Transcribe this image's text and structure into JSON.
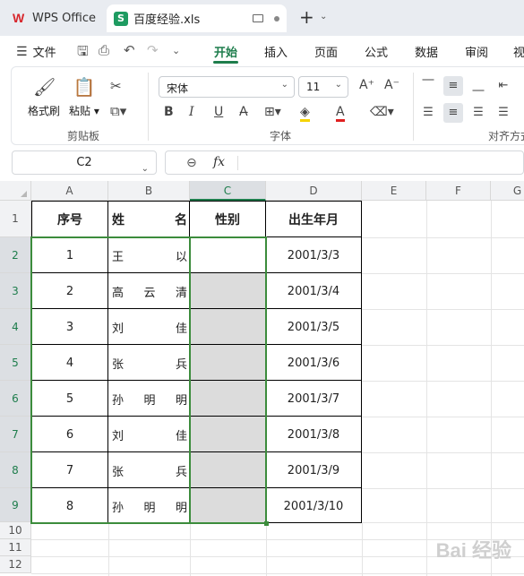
{
  "tabs": {
    "app_label": "WPS Office",
    "file_label": "百度经验.xls",
    "file_icon_letter": "S"
  },
  "menu": {
    "file": "文件",
    "tabs": [
      "开始",
      "插入",
      "页面",
      "公式",
      "数据",
      "审阅",
      "视"
    ],
    "active": "开始"
  },
  "ribbon": {
    "format_painter": "格式刷",
    "paste": "粘贴",
    "clipboard_group": "剪贴板",
    "font_group": "字体",
    "align_group": "对齐方式",
    "font_name": "宋体",
    "font_size": "11"
  },
  "formula": {
    "cell_ref": "C2",
    "fx": "fx",
    "content": ""
  },
  "sheet": {
    "columns": [
      "A",
      "B",
      "C",
      "D",
      "E",
      "F",
      "G"
    ],
    "rows": [
      "1",
      "2",
      "3",
      "4",
      "5",
      "6",
      "7",
      "8",
      "9",
      "10",
      "11",
      "12"
    ],
    "headers": {
      "a": "序号",
      "b1": "姓",
      "b2": "名",
      "c": "性别",
      "d": "出生年月"
    },
    "records": [
      {
        "no": "1",
        "name": [
          "王",
          "",
          "以"
        ],
        "date": "2001/3/3"
      },
      {
        "no": "2",
        "name": [
          "高",
          "云",
          "清"
        ],
        "date": "2001/3/4"
      },
      {
        "no": "3",
        "name": [
          "刘",
          "",
          "佳"
        ],
        "date": "2001/3/5"
      },
      {
        "no": "4",
        "name": [
          "张",
          "",
          "兵"
        ],
        "date": "2001/3/6"
      },
      {
        "no": "5",
        "name": [
          "孙",
          "明",
          "明"
        ],
        "date": "2001/3/7"
      },
      {
        "no": "6",
        "name": [
          "刘",
          "",
          "佳"
        ],
        "date": "2001/3/8"
      },
      {
        "no": "7",
        "name": [
          "张",
          "",
          "兵"
        ],
        "date": "2001/3/9"
      },
      {
        "no": "8",
        "name": [
          "孙",
          "明",
          "明"
        ],
        "date": "2001/3/10"
      }
    ]
  },
  "watermark": "Bai 经验",
  "colors": {
    "accent": "#1e7d4c",
    "selection_border": "#3c8c3c",
    "wps_red": "#d7262c"
  }
}
